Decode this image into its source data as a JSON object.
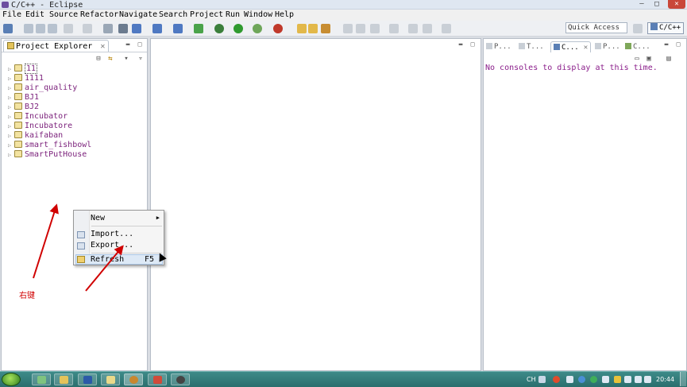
{
  "window": {
    "title": "C/C++ - Eclipse",
    "minimize": "—",
    "maximize": "□",
    "close": "✕"
  },
  "menu": [
    "File",
    "Edit",
    "Source",
    "Refactor",
    "Navigate",
    "Search",
    "Project",
    "Run",
    "Window",
    "Help"
  ],
  "toolbar": {
    "quick_access": "Quick Access",
    "perspective": "C/C++"
  },
  "explorer": {
    "title": "Project Explorer",
    "projects": [
      "11",
      "1111",
      "air_quality",
      "BJ1",
      "BJ2",
      "Incubator",
      "Incubatore",
      "kaifaban",
      "smart_fishbowl",
      "SmartPutHouse"
    ]
  },
  "console": {
    "tabs": [
      "P...",
      "T...",
      "C...",
      "P...",
      "C..."
    ],
    "message": "No consoles to display at this time."
  },
  "context_menu": {
    "new_label": "New",
    "import_label": "Import...",
    "export_label": "Export...",
    "refresh_label": "Refresh",
    "refresh_shortcut": "F5"
  },
  "annotation": {
    "text": "右键",
    "color": "#d00000"
  },
  "taskbar": {
    "lang": "CH",
    "time": "20:44"
  },
  "colors": {
    "project_text": "#7a1f7a",
    "console_text": "#8a1d8a",
    "taskbar": "#2b6f6e"
  }
}
